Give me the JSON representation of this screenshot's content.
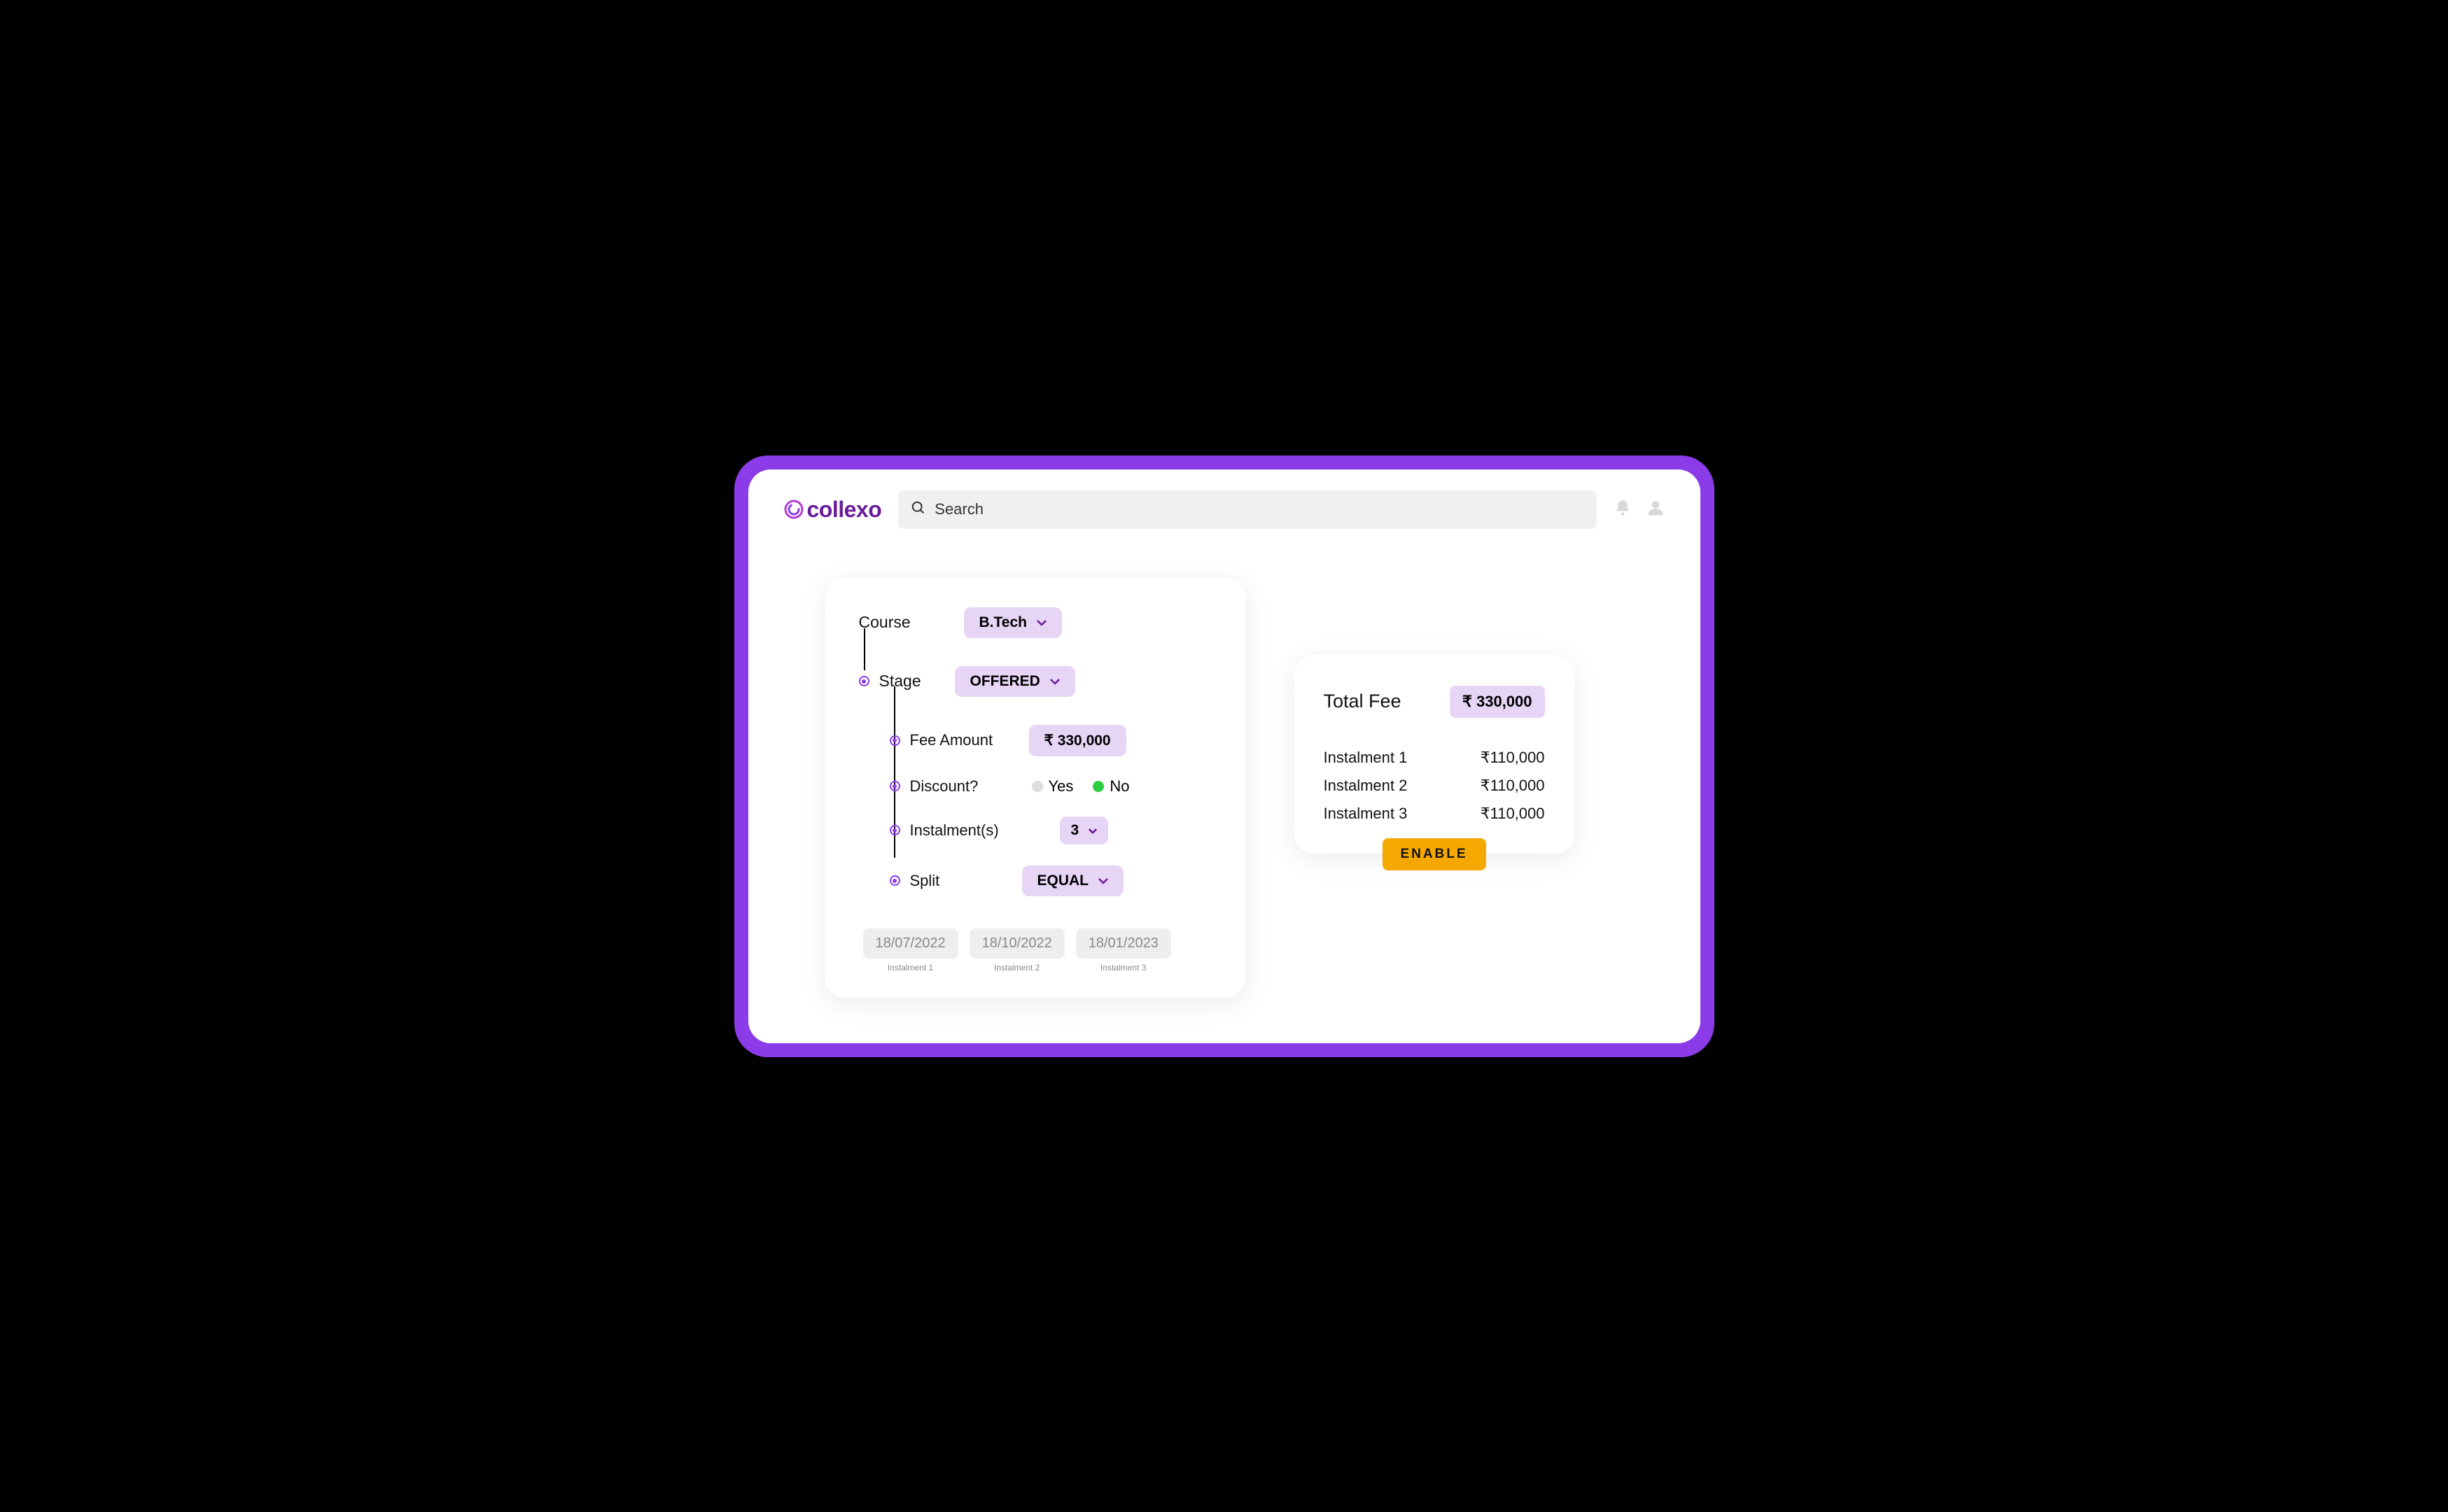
{
  "logo_text": "collexo",
  "search": {
    "placeholder": "Search"
  },
  "config": {
    "course_label": "Course",
    "course_value": "B.Tech",
    "stage_label": "Stage",
    "stage_value": "OFFERED",
    "fee_label": "Fee Amount",
    "fee_value": "₹ 330,000",
    "discount_label": "Discount?",
    "discount_yes": "Yes",
    "discount_no": "No",
    "instalments_label": "Instalment(s)",
    "instalments_value": "3",
    "split_label": "Split",
    "split_value": "EQUAL"
  },
  "dates": [
    {
      "value": "18/07/2022",
      "caption": "Instalment 1"
    },
    {
      "value": "18/10/2022",
      "caption": "Instalment 2"
    },
    {
      "value": "18/01/2023",
      "caption": "Instalment 3"
    }
  ],
  "summary": {
    "title": "Total Fee",
    "total": "₹ 330,000",
    "rows": [
      {
        "label": "Instalment 1",
        "value": "₹110,000"
      },
      {
        "label": "Instalment 2",
        "value": "₹110,000"
      },
      {
        "label": "Instalment 3",
        "value": "₹110,000"
      }
    ],
    "button": "ENABLE"
  }
}
